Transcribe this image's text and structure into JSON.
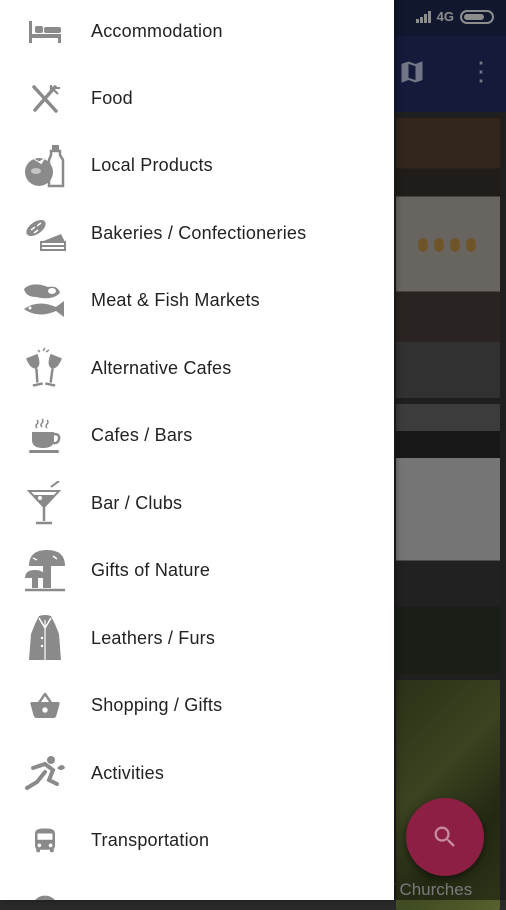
{
  "status_bar": {
    "network": "4G"
  },
  "card_caption": "/ Churches",
  "menu": {
    "items": [
      {
        "label": "Accommodation",
        "icon": "bed-icon"
      },
      {
        "label": "Food",
        "icon": "fork-knife-icon"
      },
      {
        "label": "Local Products",
        "icon": "tomato-bottle-icon"
      },
      {
        "label": "Bakeries / Confectioneries",
        "icon": "bread-cake-icon"
      },
      {
        "label": "Meat & Fish Markets",
        "icon": "meat-fish-icon"
      },
      {
        "label": "Alternative Cafes",
        "icon": "wine-glasses-icon"
      },
      {
        "label": "Cafes / Bars",
        "icon": "coffee-cup-icon"
      },
      {
        "label": "Bar / Clubs",
        "icon": "cocktail-icon"
      },
      {
        "label": "Gifts of Nature",
        "icon": "mushroom-icon"
      },
      {
        "label": "Leathers / Furs",
        "icon": "leather-coat-icon"
      },
      {
        "label": "Shopping / Gifts",
        "icon": "shopping-basket-icon"
      },
      {
        "label": "Activities",
        "icon": "running-icon"
      },
      {
        "label": "Transportation",
        "icon": "bus-icon"
      },
      {
        "label": "",
        "icon": "info-icon"
      }
    ]
  }
}
